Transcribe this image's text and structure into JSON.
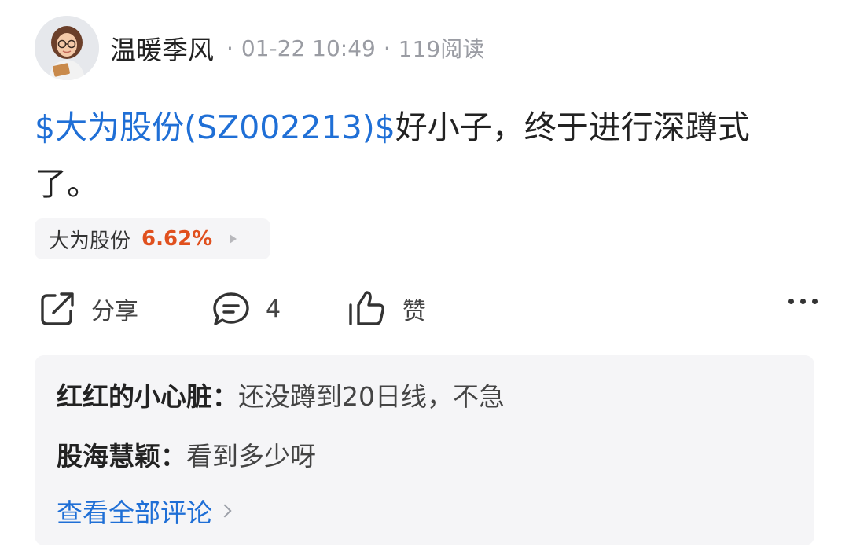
{
  "author": {
    "name": "温暖季风",
    "avatar_icon": "avatar-girl-with-glasses-reading"
  },
  "meta": {
    "separator": "·",
    "timestamp": "01-22 10:49",
    "reads": "119阅读"
  },
  "post": {
    "stock_link": "$大为股份(SZ002213)$",
    "text": "好小子，终于进行深蹲式了。"
  },
  "stock_chip": {
    "name": "大为股份",
    "change": "6.62%",
    "change_color": "#e0501e",
    "icon": "chevron-right-icon"
  },
  "actions": {
    "share_label": "分享",
    "share_icon": "share-icon",
    "comment_count": "4",
    "comment_icon": "comment-icon",
    "like_label": "赞",
    "like_icon": "thumbs-up-icon",
    "more_icon": "more-dots-icon"
  },
  "comments": {
    "items": [
      {
        "author": "红红的小心脏：",
        "text": "还没蹲到20日线，不急"
      },
      {
        "author": "股海慧颖：",
        "text": "看到多少呀"
      }
    ],
    "view_all": "查看全部评论"
  },
  "colors": {
    "link_blue": "#1f6fd6",
    "rise_red": "#e0501e",
    "panel_bg": "#f5f5f7",
    "meta_gray": "#9a9ca3"
  }
}
